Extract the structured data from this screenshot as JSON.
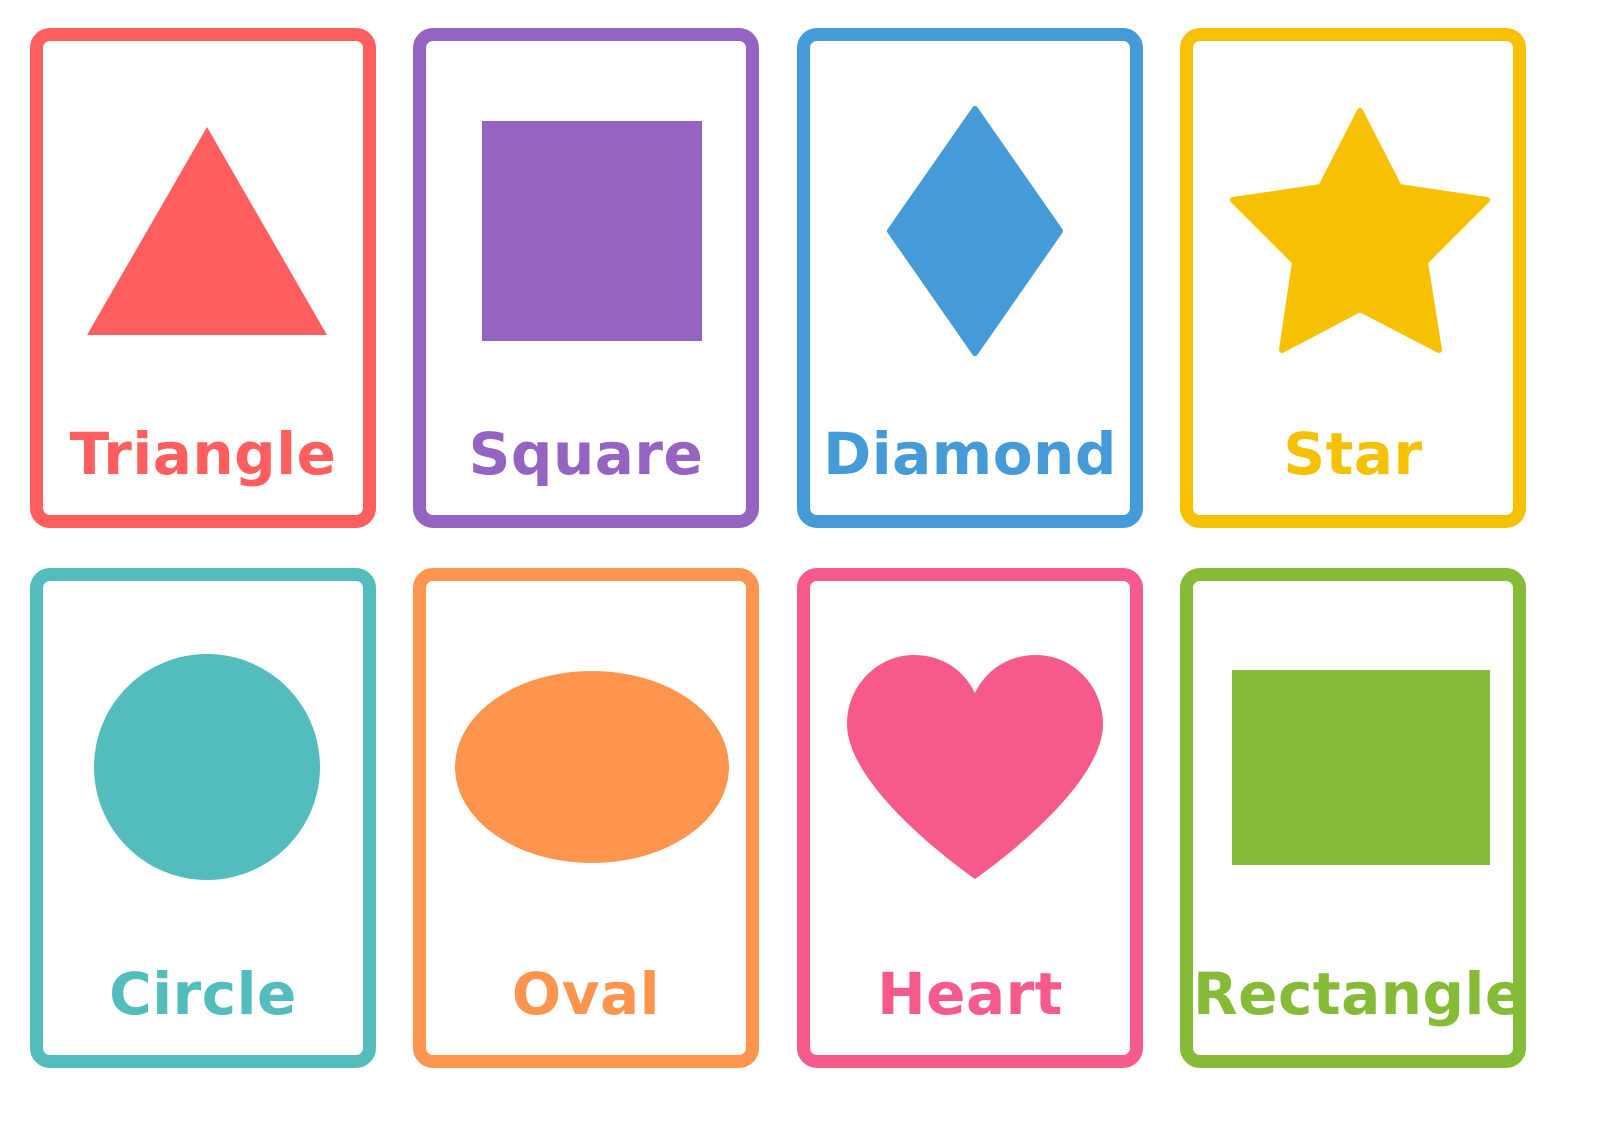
{
  "cards": [
    {
      "label": "Triangle",
      "color": "#FF5E5E",
      "icon": "triangle-icon"
    },
    {
      "label": "Square",
      "color": "#9563C2",
      "icon": "square-icon"
    },
    {
      "label": "Diamond",
      "color": "#459AD8",
      "icon": "diamond-icon"
    },
    {
      "label": "Star",
      "color": "#F6C103",
      "icon": "star-icon"
    },
    {
      "label": "Circle",
      "color": "#52BDBC",
      "icon": "circle-icon"
    },
    {
      "label": "Oval",
      "color": "#FD954E",
      "icon": "oval-icon"
    },
    {
      "label": "Heart",
      "color": "#F65A8A",
      "icon": "heart-icon"
    },
    {
      "label": "Rectangle",
      "color": "#86BB37",
      "icon": "rectangle-icon"
    }
  ]
}
